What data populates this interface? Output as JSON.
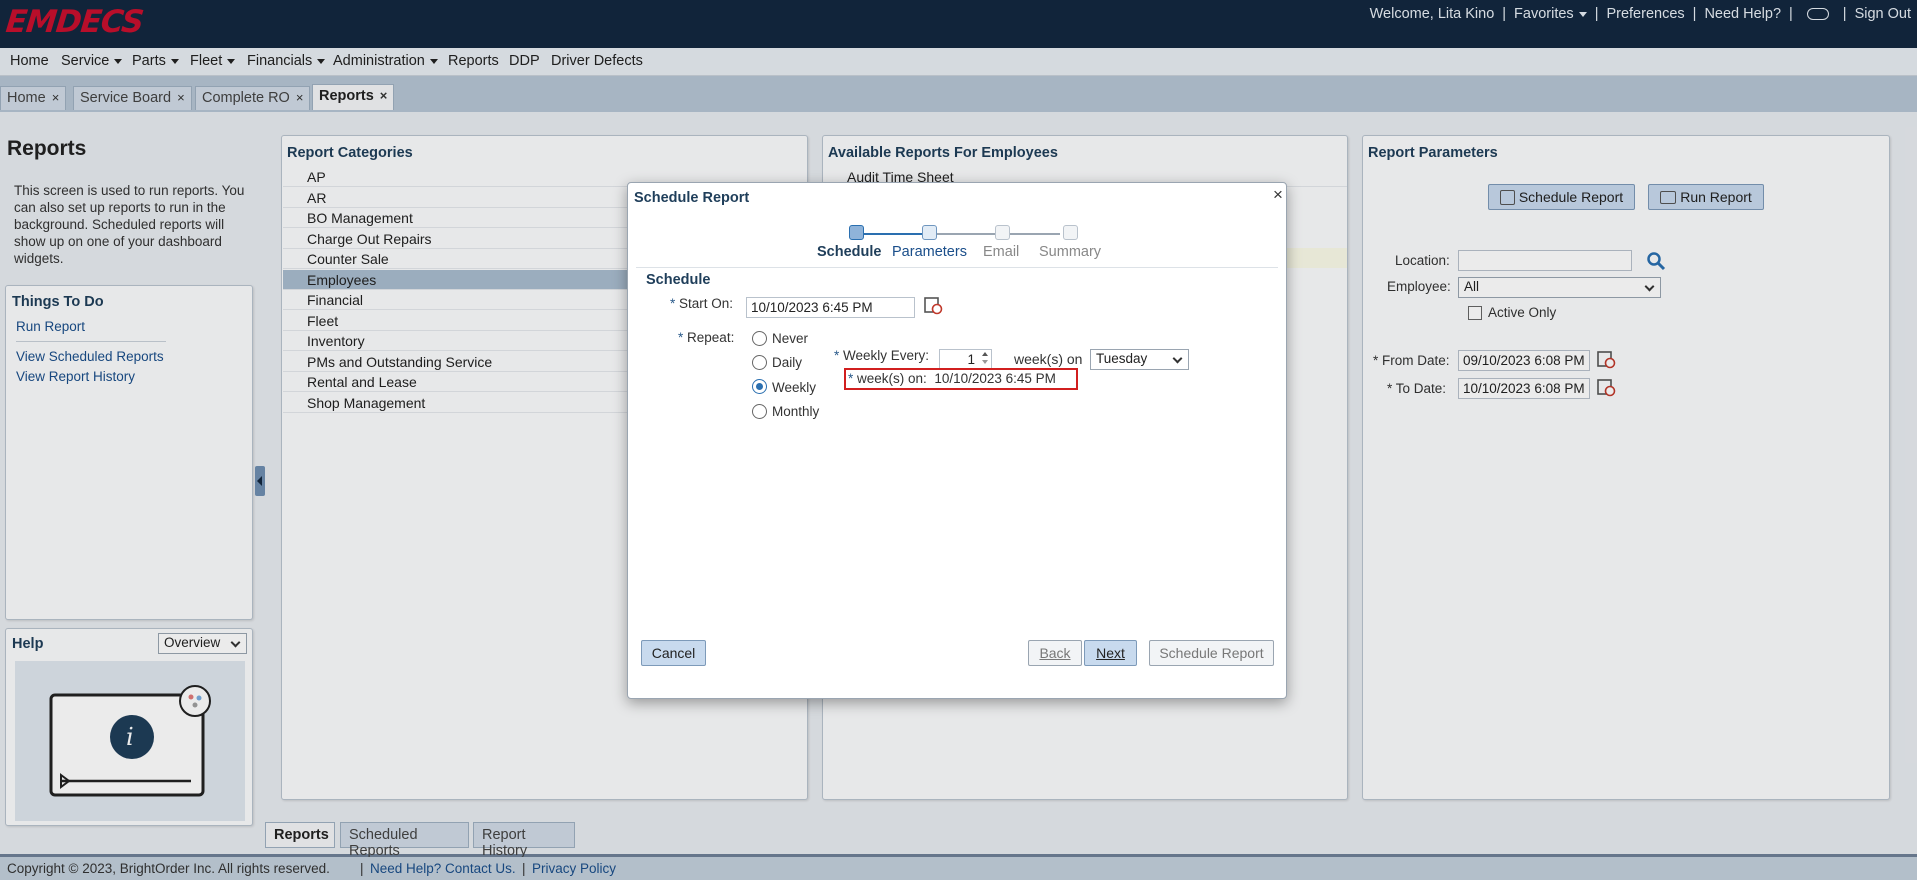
{
  "header": {
    "logo": "EMDECS",
    "welcome": "Welcome, Lita Kino",
    "favorites": "Favorites",
    "preferences": "Preferences",
    "need_help": "Need Help?",
    "sign_out": "Sign Out",
    "sep": "|"
  },
  "menu": [
    "Home",
    "Service",
    "Parts",
    "Fleet",
    "Financials",
    "Administration",
    "Reports",
    "DDP",
    "Driver Defects"
  ],
  "tabs": [
    "Home",
    "Service Board",
    "Complete RO",
    "Reports"
  ],
  "tab_close": "×",
  "left": {
    "title": "Reports",
    "description": "This screen is used to run reports. You can also set up reports to run in the background. Scheduled reports will show up on one of your dashboard widgets.",
    "todo_title": "Things To Do",
    "todo_links": [
      "Run Report",
      "View Scheduled Reports",
      "View Report History"
    ],
    "help_title": "Help",
    "help_select": "Overview",
    "help_icon_letter": "i"
  },
  "categories": {
    "title": "Report Categories",
    "items": [
      "AP",
      "AR",
      "BO Management",
      "Charge Out Repairs",
      "Counter Sale",
      "Employees",
      "Financial",
      "Fleet",
      "Inventory",
      "PMs and Outstanding Service",
      "Rental and Lease",
      "Shop Management"
    ],
    "selected": "Employees"
  },
  "available": {
    "title": "Available Reports For Employees",
    "items": [
      "Audit Time Sheet"
    ]
  },
  "params": {
    "title": "Report Parameters",
    "schedule_btn": "Schedule Report",
    "run_btn": "Run Report",
    "location_label": "Location:",
    "location_value": "",
    "employee_label": "Employee:",
    "employee_value": "All",
    "active_only": "Active Only",
    "from_label": "* From Date:",
    "from_value": "09/10/2023 6:08 PM",
    "to_label": "* To Date:",
    "to_value": "10/10/2023 6:08 PM"
  },
  "bottom_tabs": [
    "Reports",
    "Scheduled Reports",
    "Report History"
  ],
  "footer": {
    "copyright": "Copyright © 2023, BrightOrder Inc. All rights reserved.",
    "help": "Need Help? Contact Us.",
    "privacy": "Privacy Policy",
    "sep": "|"
  },
  "modal": {
    "title": "Schedule Report",
    "close": "×",
    "steps": [
      "Schedule",
      "Parameters",
      "Email",
      "Summary"
    ],
    "section": "Schedule",
    "start_label": "Start On:",
    "start_value": "10/10/2023 6:45 PM",
    "repeat_label": "Repeat:",
    "repeat_options": [
      "Never",
      "Daily",
      "Weekly",
      "Monthly"
    ],
    "repeat_selected": "Weekly",
    "weekly_every_label": "Weekly Every:",
    "weekly_every_value": "1",
    "weeks_on_text": "week(s) on",
    "weekday": "Tuesday",
    "weeks_on_label": "week(s) on:",
    "weeks_on_value": "10/10/2023 6:45 PM",
    "req": "*",
    "cancel": "Cancel",
    "back": "Back",
    "next": "Next",
    "schedule": "Schedule Report"
  },
  "colors": {
    "brand": "#c8102e",
    "header": "#13283f",
    "highlight_box": "#d11f1f"
  }
}
